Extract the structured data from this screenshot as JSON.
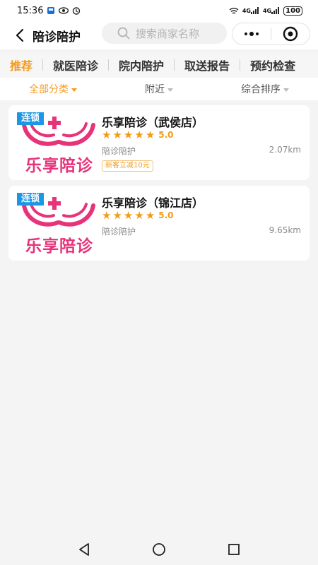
{
  "status_bar": {
    "time": "15:36",
    "network_a": "4G",
    "network_b": "4G",
    "battery": "100"
  },
  "header": {
    "title": "陪诊陪护",
    "search_placeholder": "搜索商家名称"
  },
  "category_tabs": [
    "推荐",
    "就医陪诊",
    "院内陪护",
    "取送报告",
    "预约检查"
  ],
  "filters": [
    {
      "label": "全部分类",
      "active": true
    },
    {
      "label": "附近",
      "active": false
    },
    {
      "label": "综合排序",
      "active": false
    }
  ],
  "stores": [
    {
      "badge": "连锁",
      "logo_text": "乐享陪诊",
      "name": "乐享陪诊（武侯店）",
      "rating": "5.0",
      "category": "陪诊陪护",
      "distance": "2.07km",
      "promo": "新客立减10元"
    },
    {
      "badge": "连锁",
      "logo_text": "乐享陪诊",
      "name": "乐享陪诊（锦江店）",
      "rating": "5.0",
      "category": "陪诊陪护",
      "distance": "9.65km",
      "promo": ""
    }
  ],
  "colors": {
    "accent": "#f39a1e",
    "badge": "#1a97e5",
    "brand_pink": "#e7337a"
  },
  "icons": [
    "back-icon",
    "search-icon",
    "more-icon",
    "target-icon",
    "star-icon",
    "nav-back-icon",
    "nav-home-icon",
    "nav-recent-icon"
  ]
}
